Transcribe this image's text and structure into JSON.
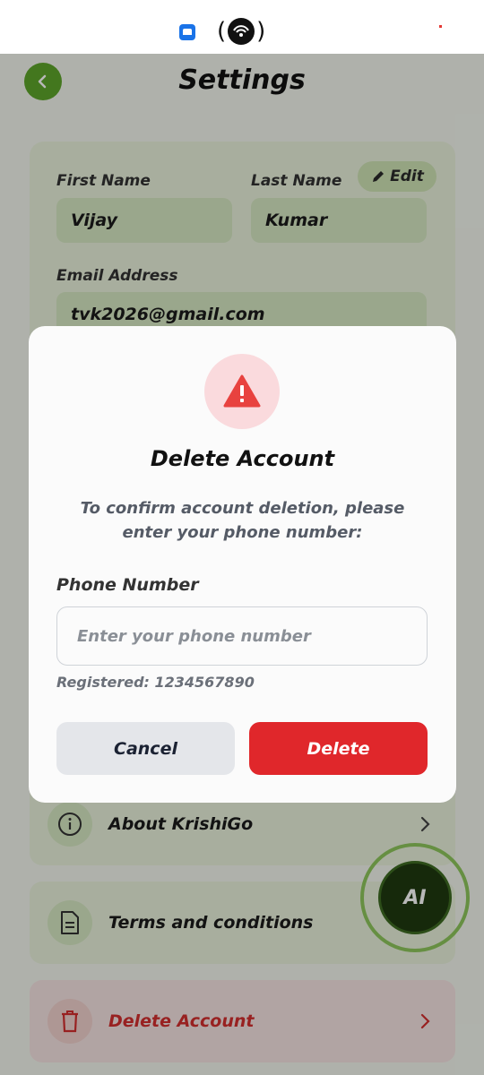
{
  "screen": {
    "title": "Settings",
    "profile": {
      "edit_label": "Edit",
      "first_name_label": "First Name",
      "first_name_value": "Vijay",
      "last_name_label": "Last Name",
      "last_name_value": "Kumar",
      "email_label": "Email Address",
      "email_value": "tvk2026@gmail.com"
    },
    "menu": [
      {
        "label": "About KrishiGo",
        "icon": "info-icon"
      },
      {
        "label": "Terms and conditions",
        "icon": "document-icon"
      },
      {
        "label": "Delete Account",
        "icon": "trash-icon"
      }
    ],
    "ai_button_label": "AI"
  },
  "dialog": {
    "title": "Delete Account",
    "message": "To confirm account deletion, please enter your phone number:",
    "phone_label": "Phone Number",
    "phone_placeholder": "Enter your phone number",
    "registered_text": "Registered: 1234567890",
    "cancel_label": "Cancel",
    "delete_label": "Delete"
  },
  "colors": {
    "brand_green": "#5ea52a",
    "danger_red": "#e0272b",
    "warning_bg": "#fadadd"
  }
}
